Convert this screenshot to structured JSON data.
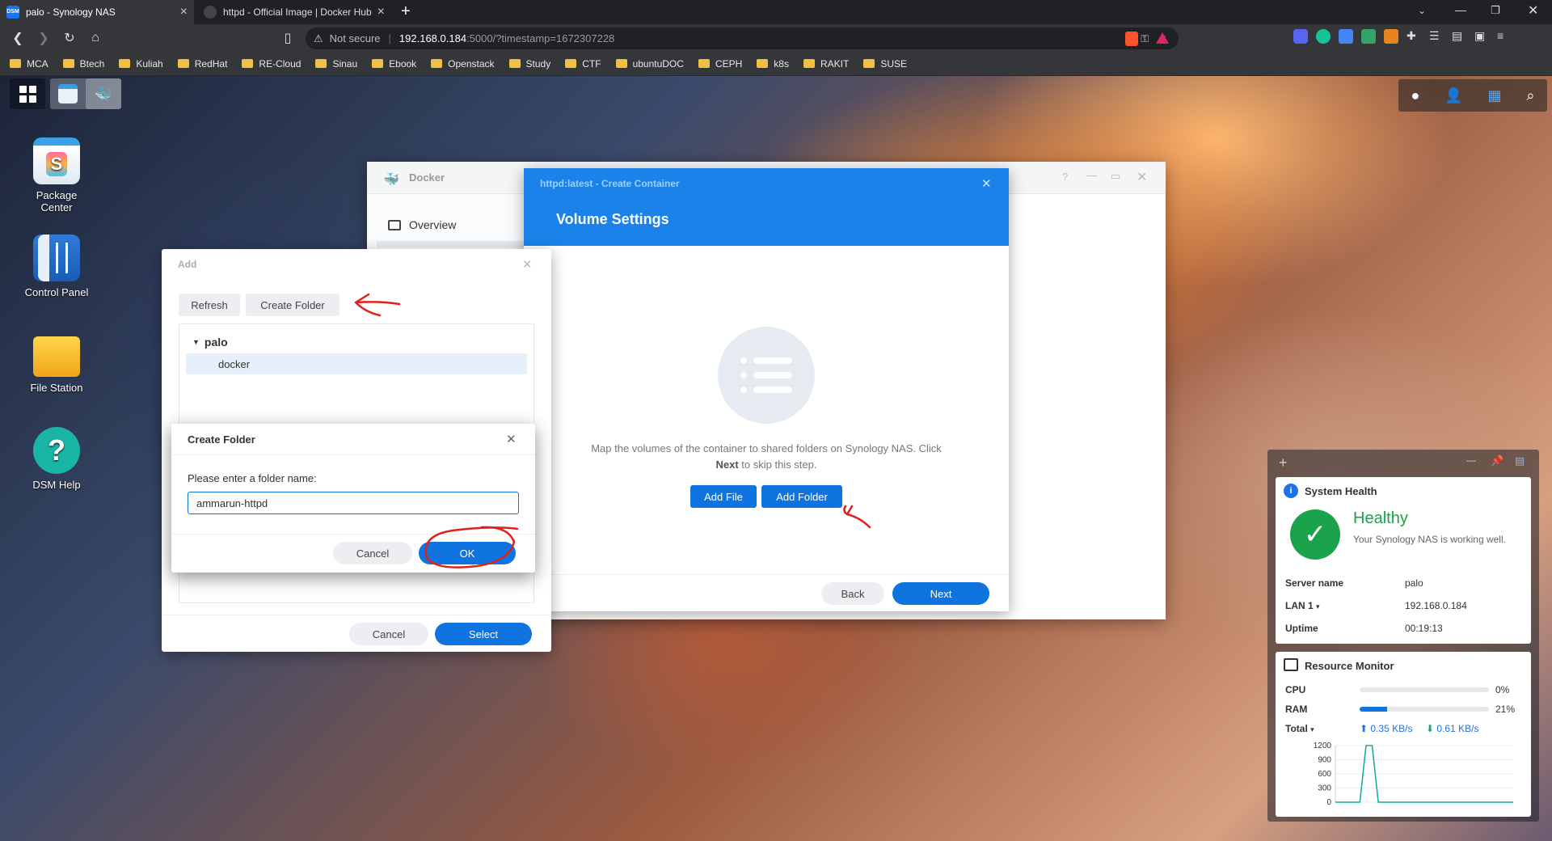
{
  "browser": {
    "tabs": [
      {
        "label": "palo - Synology NAS",
        "favicon": "DSM"
      },
      {
        "label": "httpd - Official Image | Docker Hub"
      }
    ],
    "new_tab": "+",
    "security": "Not secure",
    "url_host": "192.168.0.184",
    "url_rest": ":5000/?timestamp=1672307228",
    "bookmarks": [
      "MCA",
      "Btech",
      "Kuliah",
      "RedHat",
      "RE-Cloud",
      "Sinau",
      "Ebook",
      "Openstack",
      "Study",
      "CTF",
      "ubuntuDOC",
      "CEPH",
      "k8s",
      "RAKIT",
      "SUSE"
    ]
  },
  "desktop": {
    "icons": [
      {
        "label": "Package\nCenter",
        "icon": "package-center-icon"
      },
      {
        "label": "Control Panel",
        "icon": "control-panel-icon"
      },
      {
        "label": "File Station",
        "icon": "file-station-icon"
      },
      {
        "label": "DSM Help",
        "icon": "help-icon"
      }
    ]
  },
  "docker_window": {
    "title": "Docker",
    "nav_overview": "Overview"
  },
  "create_container": {
    "title": "httpd:latest - Create Container",
    "heading": "Volume Settings",
    "description_1": "Map the volumes of the container to shared folders on Synology NAS. Click",
    "description_2_bold": "Next",
    "description_2_rest": " to skip this step.",
    "add_file": "Add File",
    "add_folder": "Add Folder",
    "back": "Back",
    "next": "Next"
  },
  "add_dialog": {
    "title": "Add",
    "refresh": "Refresh",
    "create_folder": "Create Folder",
    "tree_root": "palo",
    "tree_child": "docker",
    "cancel": "Cancel",
    "select": "Select"
  },
  "create_folder_dialog": {
    "title": "Create Folder",
    "prompt": "Please enter a folder name:",
    "value": "ammarun-httpd",
    "cancel": "Cancel",
    "ok": "OK"
  },
  "system_health": {
    "title": "System Health",
    "status": "Healthy",
    "message": "Your Synology NAS is working well.",
    "server_name_label": "Server name",
    "server_name": "palo",
    "lan_label": "LAN 1",
    "lan": "192.168.0.184",
    "uptime_label": "Uptime",
    "uptime": "00:19:13"
  },
  "resource_monitor": {
    "title": "Resource Monitor",
    "cpu_label": "CPU",
    "cpu": "0%",
    "cpu_fraction": 0.0,
    "ram_label": "RAM",
    "ram": "21%",
    "ram_fraction": 0.21,
    "total_label": "Total",
    "upload": "0.35 KB/s",
    "download": "0.61 KB/s",
    "y_ticks": [
      "1200",
      "900",
      "600",
      "300",
      "0"
    ]
  },
  "chart_data": {
    "type": "line",
    "series": [
      {
        "values": [
          0,
          0,
          0,
          0,
          0,
          1200,
          1200,
          0,
          0,
          0,
          0,
          0,
          0,
          0,
          0,
          0,
          0,
          0,
          0,
          0,
          0,
          0,
          0,
          0,
          0,
          0,
          0,
          0,
          0,
          0
        ]
      }
    ],
    "ylim": [
      0,
      1200
    ],
    "yticks": [
      1200,
      900,
      600,
      300,
      0
    ]
  },
  "colors": {
    "accent": "#0f74df",
    "healthy": "#1aa34a",
    "annotation": "#e0201a"
  }
}
